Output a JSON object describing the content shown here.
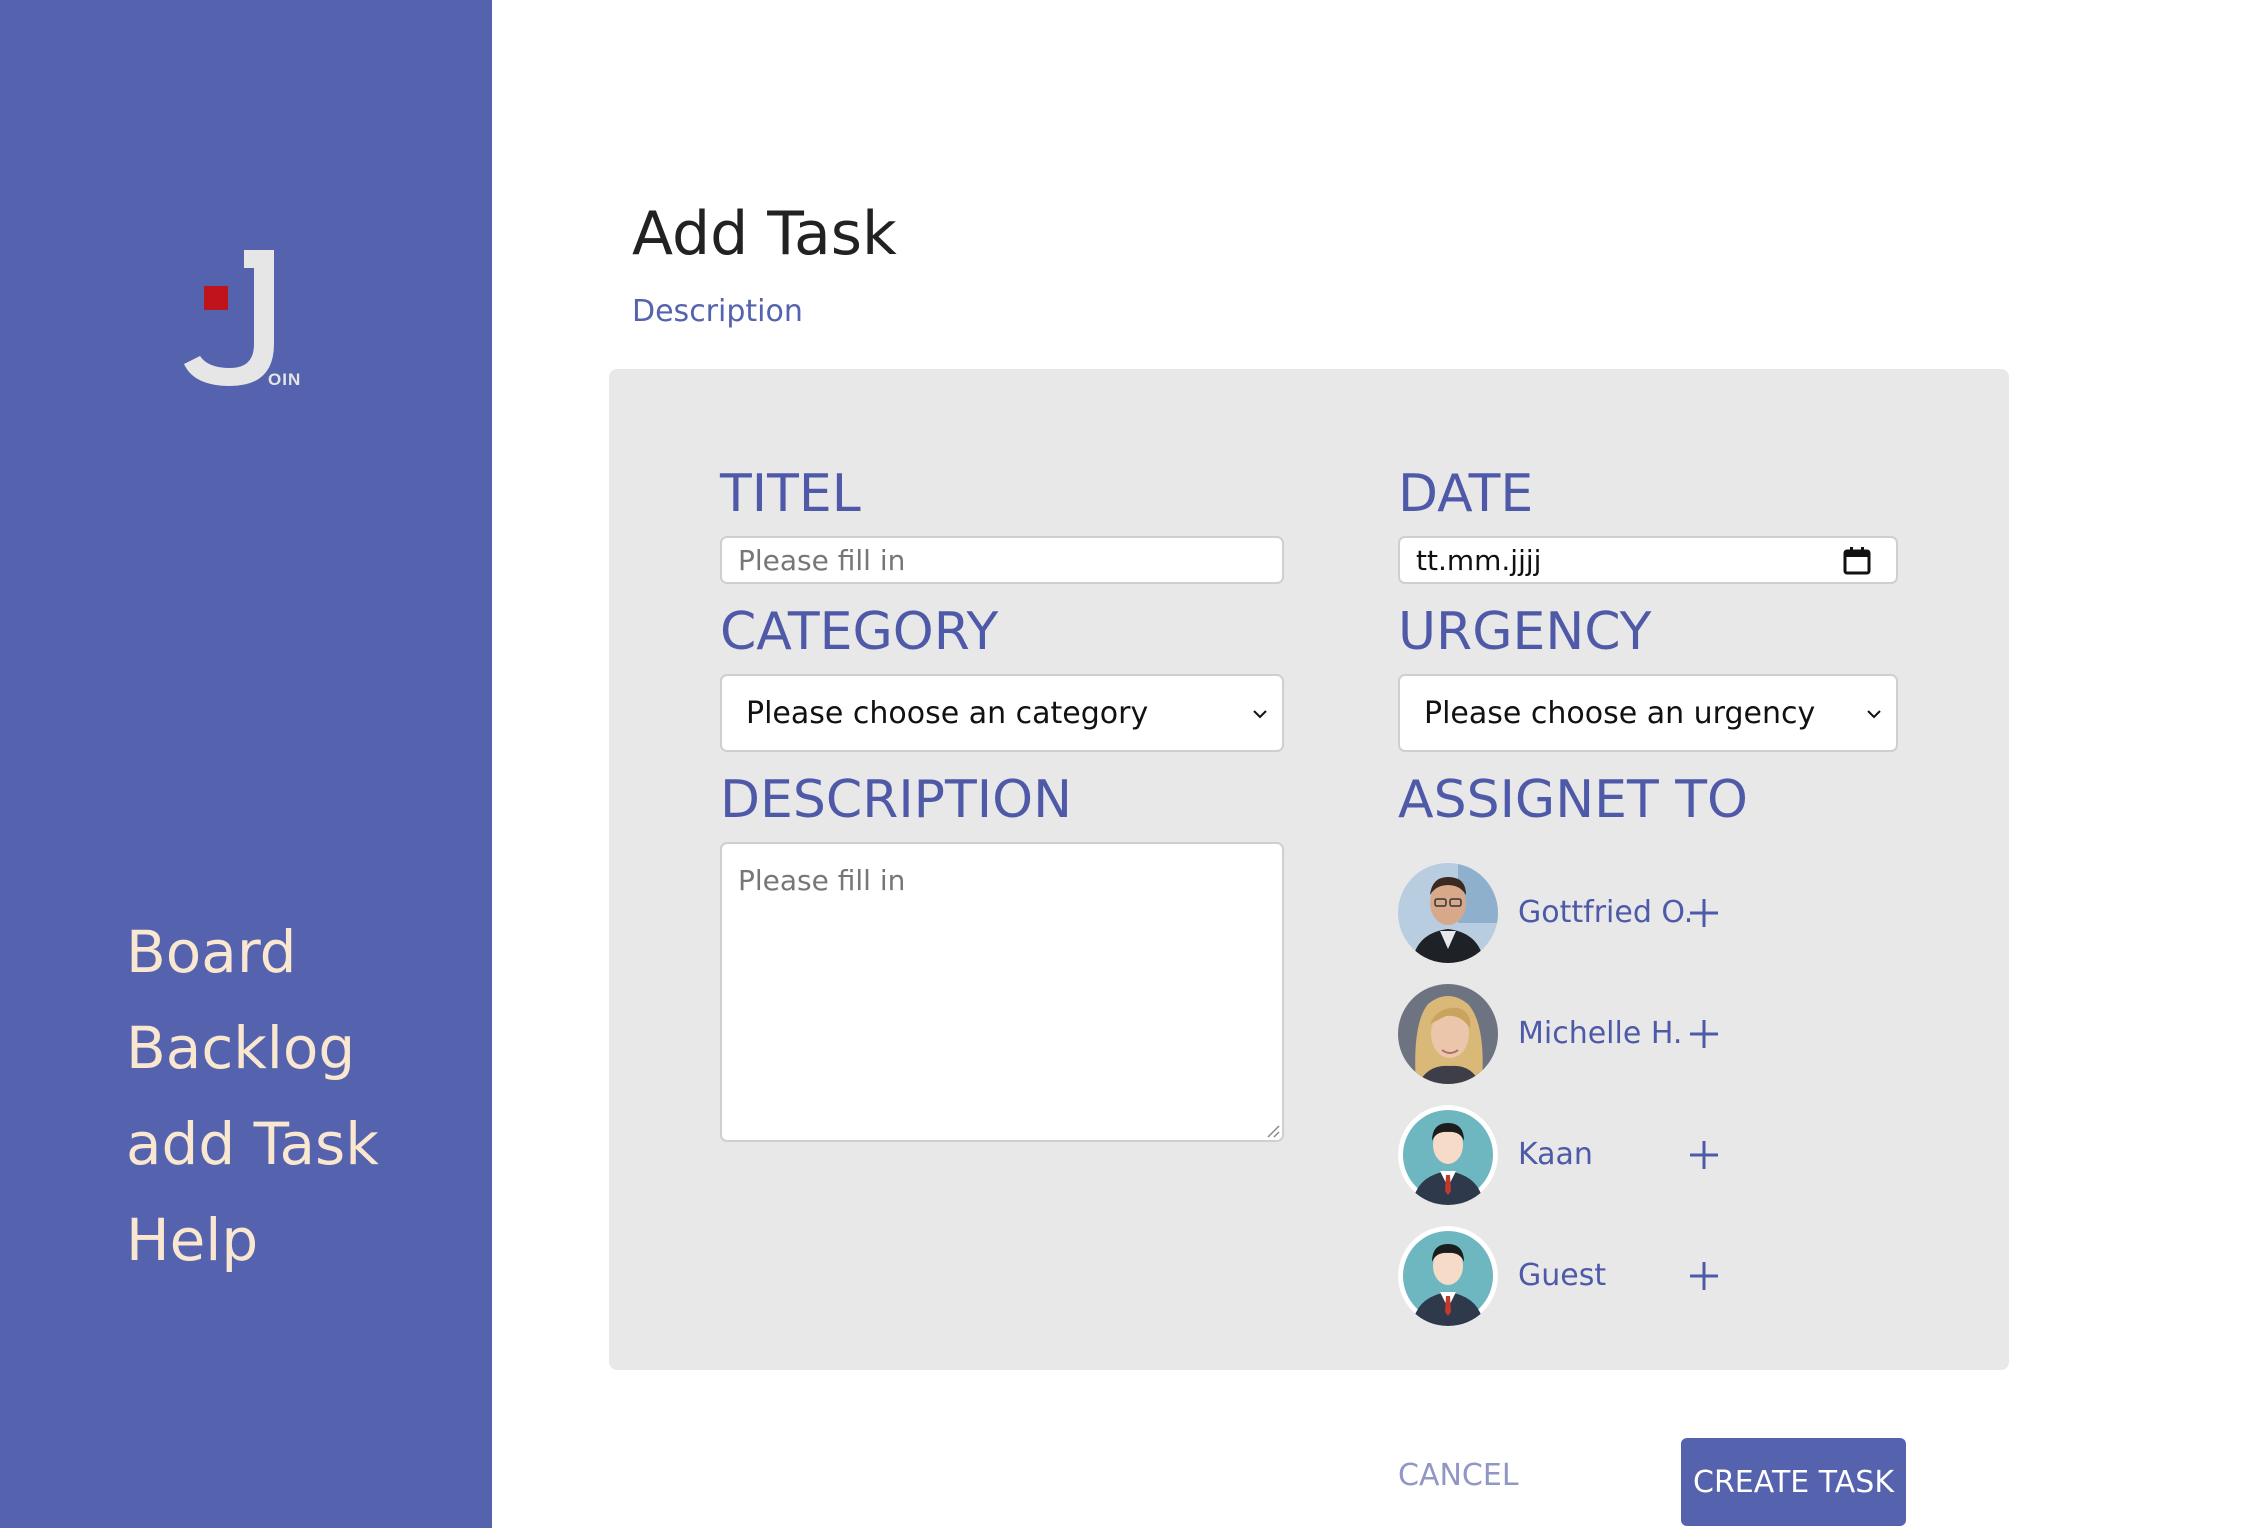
{
  "brand": {
    "logo_text": "OIN"
  },
  "nav": {
    "items": [
      {
        "label": "Board"
      },
      {
        "label": "Backlog"
      },
      {
        "label": "add Task"
      },
      {
        "label": "Help"
      }
    ]
  },
  "header": {
    "title": "Add Task",
    "subtitle": "Description"
  },
  "form": {
    "title_label": "TITEL",
    "title_placeholder": "Please fill in",
    "date_label": "DATE",
    "date_value": "tt.mm.jjjj",
    "category_label": "CATEGORY",
    "category_selected": "Please choose an category",
    "urgency_label": "URGENCY",
    "urgency_selected": "Please choose an urgency",
    "description_label": "DESCRIPTION",
    "description_placeholder": "Please fill in",
    "assigned_label": "ASSIGNET TO",
    "assignees": [
      {
        "name": "Gottfried O.",
        "avatar": "photo-man"
      },
      {
        "name": "Michelle H.",
        "avatar": "photo-woman"
      },
      {
        "name": "Kaan",
        "avatar": "default-avatar"
      },
      {
        "name": "Guest",
        "avatar": "default-avatar"
      }
    ]
  },
  "actions": {
    "cancel_label": "CANCEL",
    "create_label": "CREATE TASK"
  },
  "colors": {
    "sidebar": "#5563ae",
    "nav_text": "#f9e7cf",
    "accent": "#4e5aa8",
    "card_bg": "#e8e8e8",
    "logo_red": "#c0141c"
  }
}
